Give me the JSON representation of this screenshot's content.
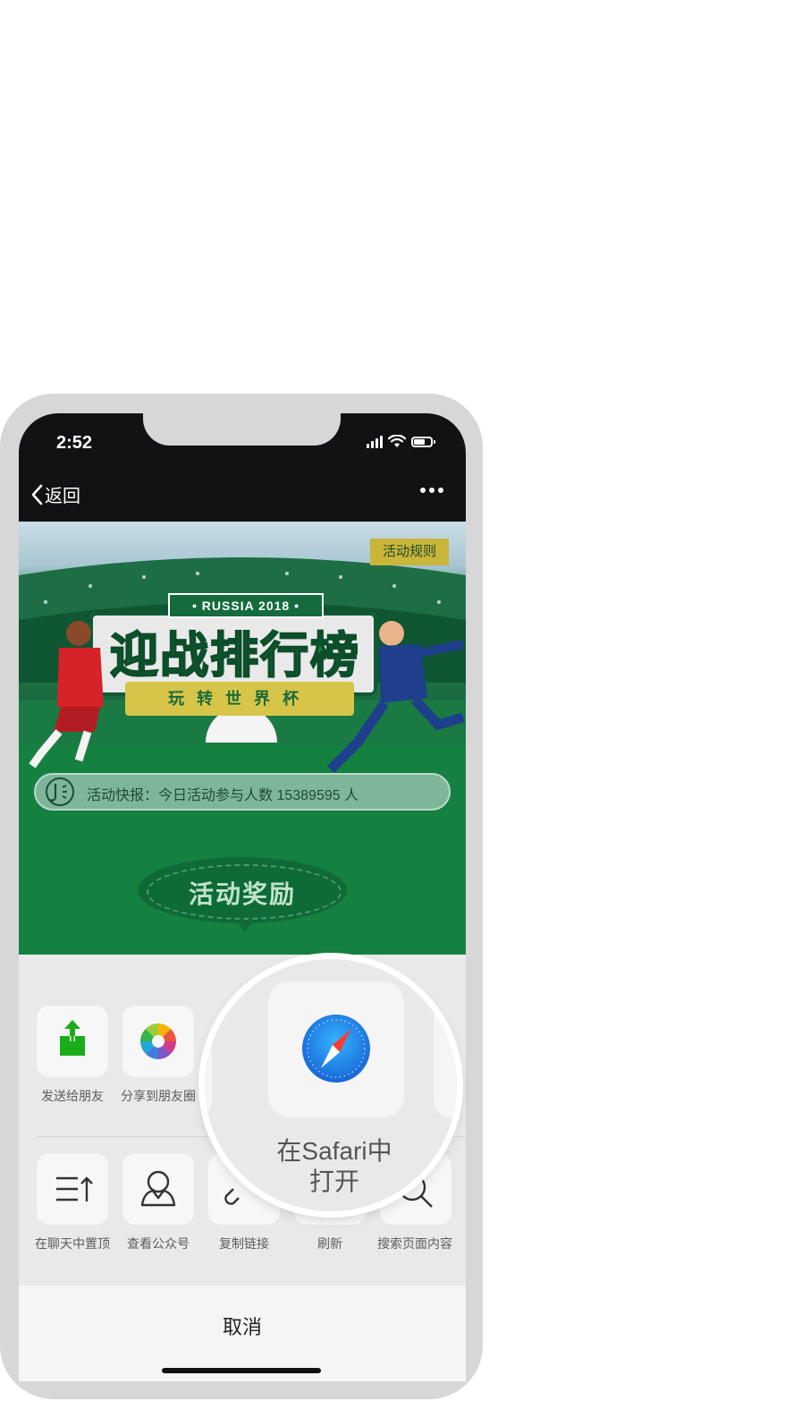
{
  "status_bar": {
    "time": "2:52"
  },
  "nav": {
    "back_label": "返回"
  },
  "banner": {
    "rules_label": "活动规则",
    "tag": "• RUSSIA 2018 •",
    "title": "迎战排行榜",
    "subtitle": "玩转世界杯",
    "ticker_text": "活动快报：今日活动参与人数 15389595 人",
    "reward_label": "活动奖励"
  },
  "share_row": [
    {
      "label": "发送给朋友",
      "icon": "share-upload-icon"
    },
    {
      "label": "分享到朋友圈",
      "icon": "moments-icon"
    }
  ],
  "action_row": [
    {
      "label": "在聊天中置顶",
      "icon": "pin-top-icon"
    },
    {
      "label": "查看公众号",
      "icon": "official-account-icon"
    },
    {
      "label": "复制链接",
      "icon": "link-icon"
    },
    {
      "label": "刷新",
      "icon": "refresh-icon"
    },
    {
      "label": "搜索页面内容",
      "icon": "search-icon"
    }
  ],
  "magnifier": {
    "label_line1": "在Safari中",
    "label_line2": "打开",
    "icon": "safari-icon"
  },
  "cancel_label": "取消",
  "colors": {
    "share_green": "#1aad19",
    "banner_green": "#12813f",
    "badge_gold": "#c9b53a"
  }
}
